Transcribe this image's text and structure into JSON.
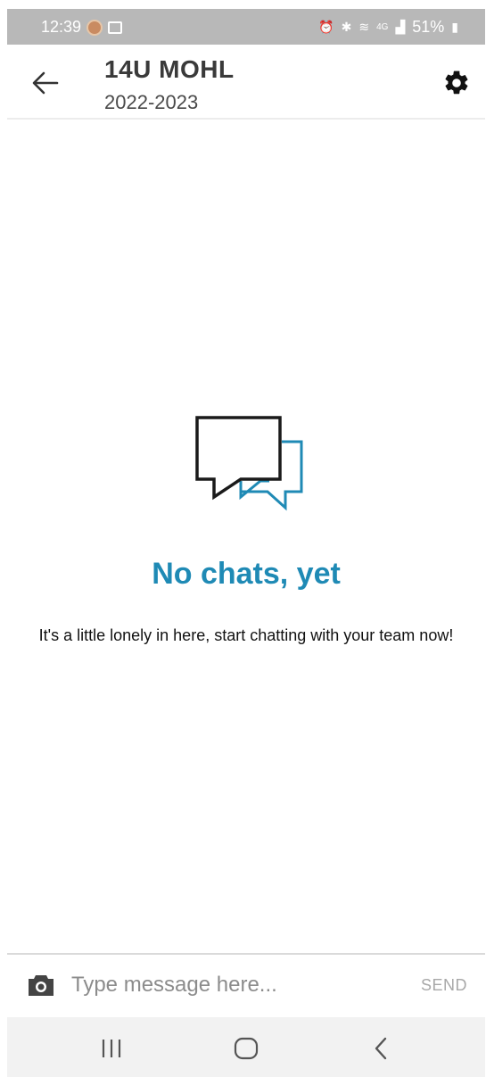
{
  "status_bar": {
    "time": "12:39",
    "battery": "51%",
    "network_type": "4G"
  },
  "header": {
    "title": "14U MOHL",
    "subtitle": "2022-2023"
  },
  "empty_state": {
    "title": "No chats, yet",
    "message": "It's a little lonely in here, start chatting with your team now!"
  },
  "composer": {
    "placeholder": "Type message here...",
    "send_label": "SEND"
  },
  "colors": {
    "accent": "#1f8ab5",
    "status_bar": "#b8b8b8",
    "text_dark": "#3a3a3a"
  },
  "icons": {
    "back": "arrow-left-icon",
    "settings": "gear-icon",
    "empty": "chat-bubbles-icon",
    "camera": "camera-icon"
  }
}
